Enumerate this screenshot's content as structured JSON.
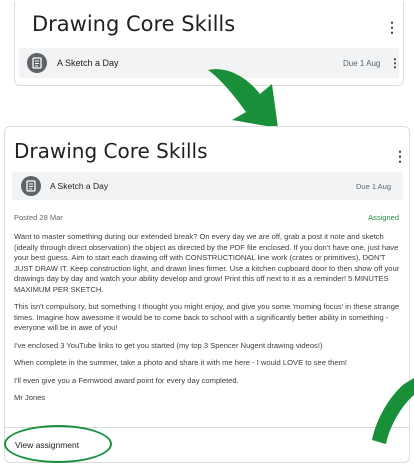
{
  "top_card": {
    "title": "Drawing Core Skills",
    "menu_glyph": "⋮",
    "assignment": {
      "title": "A Sketch a Day",
      "due": "Due 1 Aug",
      "menu_glyph": "⋮",
      "icon": "assignment-icon"
    }
  },
  "bottom_card": {
    "title": "Drawing Core Skills",
    "menu_glyph": "⋮",
    "assignment": {
      "title": "A Sketch a Day",
      "due": "Due 1 Aug",
      "icon": "assignment-icon"
    },
    "posted": "Posted 28 Mar",
    "status": "Assigned",
    "paragraphs": [
      "Want to master something during our extended break? On every day we are off, grab a post it note and sketch (ideally through direct observation) the object as directed by the PDF file enclosed. If you don't have one, just have your best guess. Aim to start each drawing off with CONSTRUCTIONAL line work (crates or primitives), DON'T JUST DRAW IT. Keep construction light, and drawn lines firmer. Use a kitchen cupboard door to then show off your drawings day by day and watch your ability develop and grow! Print this off next to it as a reminder! 5 MINUTES MAXIMUM PER SKETCH.",
      "This isn't compulsory, but something I thought you might enjoy, and give you some 'morning focus' in these strange times. Imagine how awesome it would be to come back to school with a significantly better ability in something - everyone will be in awe of you!",
      "I've enclosed 3 YouTube links to get you started (my top 3 Spencer Nugent drawing videos!)",
      "When complete in the summer, take a photo and share it with me here - I would LOVE to see them!",
      "I'll even give you a Fernwood award point for every day completed.",
      "Mr Jones"
    ],
    "view_link": "View assignment"
  },
  "colors": {
    "accent_green": "#1a8f3a",
    "status_green": "#1e8e3e",
    "row_bg": "#f1f3f4"
  }
}
